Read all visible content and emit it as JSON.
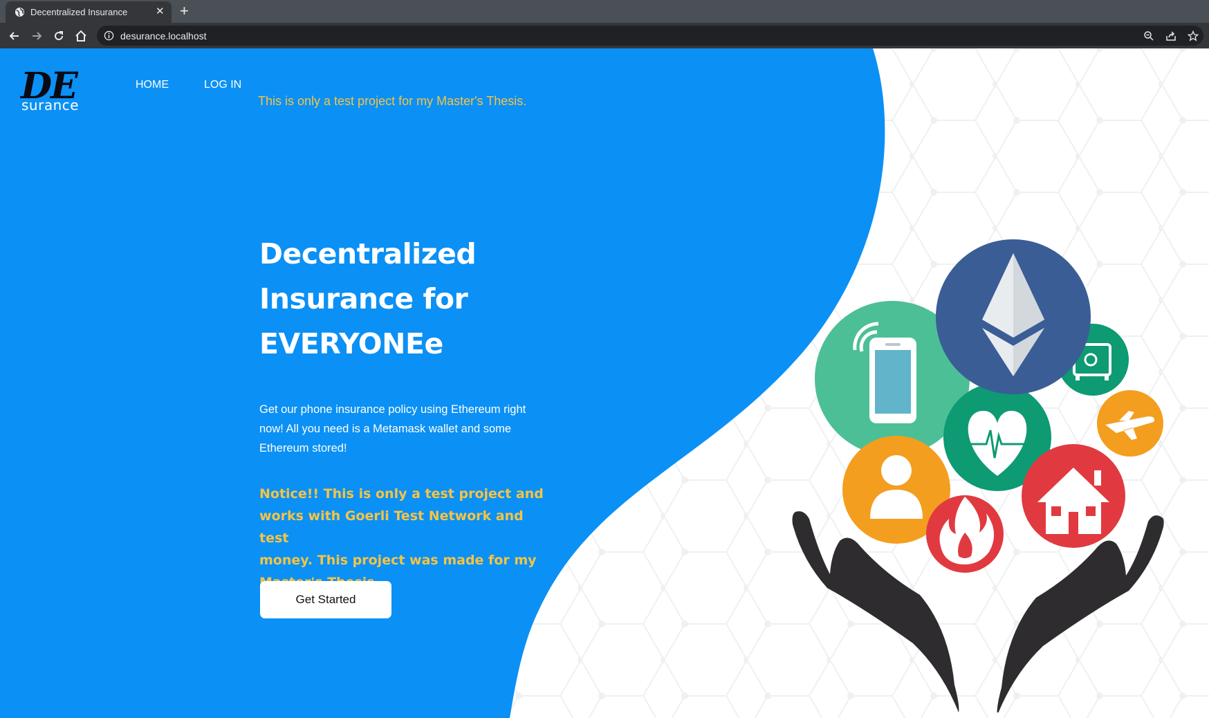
{
  "browser": {
    "tab_title": "Decentralized Insurance",
    "tab_close": "✕",
    "new_tab": "+",
    "url": "desurance.localhost"
  },
  "logo": {
    "mark": "DE",
    "subtitle": "surance"
  },
  "nav": {
    "home": "HOME",
    "login": "LOG IN"
  },
  "banner": "This is only a test project for my Master's Thesis.",
  "hero": {
    "title_lines": [
      "Decentralized",
      "Insurance for",
      "EVERYONEe"
    ],
    "description_lines": [
      "Get our phone insurance policy using Ethereum right",
      "now! All you need is a Metamask wallet and some",
      "Ethereum stored!"
    ],
    "notice_lines": [
      "Notice!! This is only a test project and",
      "works with Goerli Test Network and test",
      "money. This project was made for my",
      "Master's Thesis"
    ],
    "cta_label": "Get Started"
  },
  "colors": {
    "brand_blue": "#0b90f5",
    "accent_yellow": "#f6c443",
    "white": "#ffffff"
  }
}
